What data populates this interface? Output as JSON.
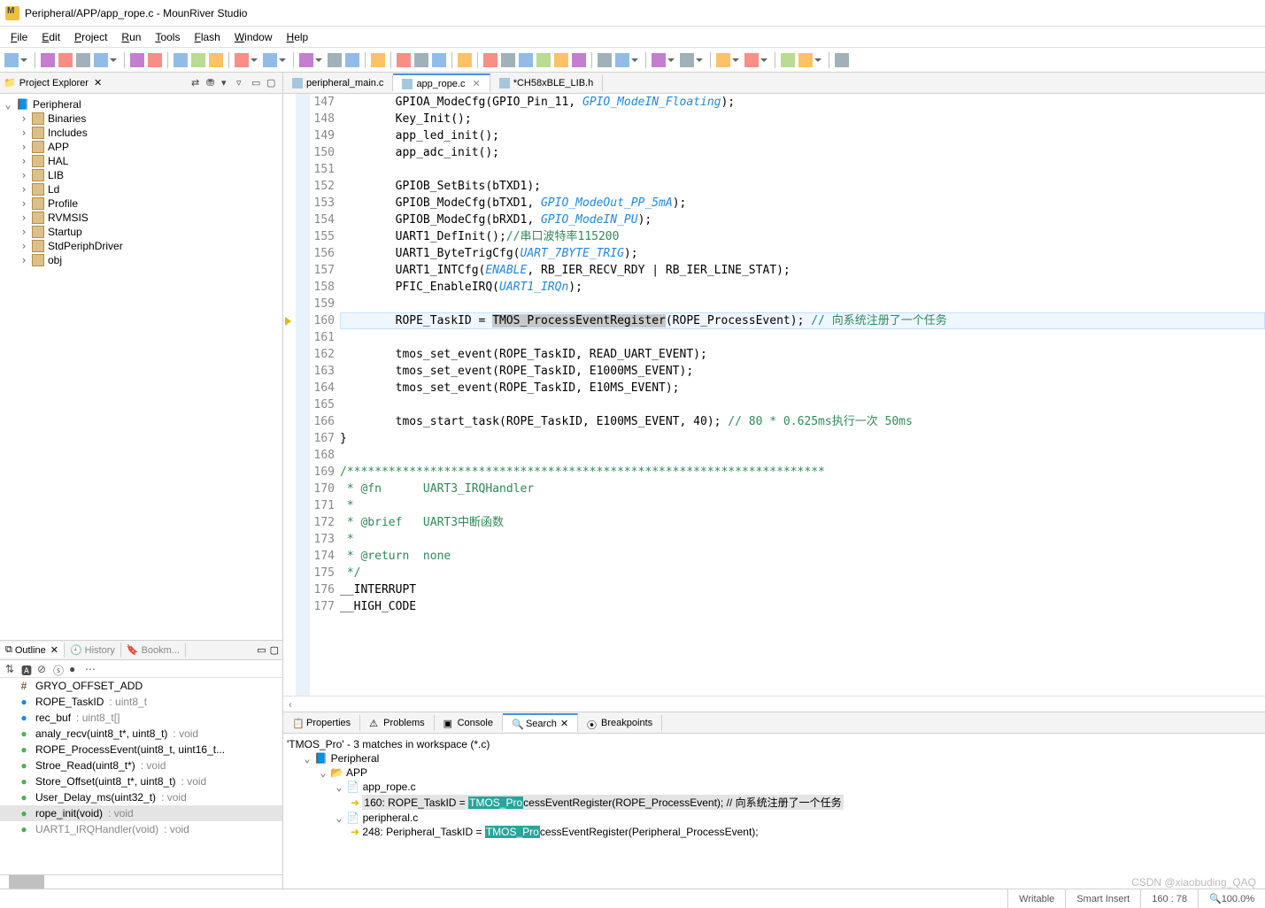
{
  "title": "Peripheral/APP/app_rope.c - MounRiver Studio",
  "menu": [
    "File",
    "Edit",
    "Project",
    "Run",
    "Tools",
    "Flash",
    "Window",
    "Help"
  ],
  "projectExplorer": {
    "title": "Project Explorer",
    "root": "Peripheral",
    "items": [
      "Binaries",
      "Includes",
      "APP",
      "HAL",
      "LIB",
      "Ld",
      "Profile",
      "RVMSIS",
      "Startup",
      "StdPeriphDriver",
      "obj"
    ]
  },
  "outline": {
    "tabs": [
      "Outline",
      "History",
      "Bookm..."
    ],
    "items": [
      {
        "k": "def",
        "t": "GRYO_OFFSET_ADD"
      },
      {
        "k": "var",
        "t": "ROPE_TaskID",
        "tp": "uint8_t"
      },
      {
        "k": "var",
        "t": "rec_buf",
        "tp": "uint8_t[]"
      },
      {
        "k": "func",
        "t": "analy_recv(uint8_t*, uint8_t)",
        "tp": "void"
      },
      {
        "k": "func",
        "t": "ROPE_ProcessEvent(uint8_t, uint16_t...",
        "tp": ""
      },
      {
        "k": "func",
        "t": "Stroe_Read(uint8_t*)",
        "tp": "void"
      },
      {
        "k": "func",
        "t": "Store_Offset(uint8_t*, uint8_t)",
        "tp": "void"
      },
      {
        "k": "func",
        "t": "User_Delay_ms(uint32_t)",
        "tp": "void"
      },
      {
        "k": "func",
        "t": "rope_init(void)",
        "tp": "void",
        "sel": true
      },
      {
        "k": "func",
        "t": "UART1_IRQHandler(void)",
        "tp": "void",
        "dim": true
      }
    ]
  },
  "editor": {
    "tabs": [
      {
        "name": "peripheral_main.c",
        "active": false
      },
      {
        "name": "app_rope.c",
        "active": true
      },
      {
        "name": "*CH58xBLE_LIB.h",
        "active": false
      }
    ],
    "firstLine": 147,
    "lines": [
      {
        "n": 147,
        "seg": [
          [
            "p",
            "        GPIOA_ModeCfg(GPIO_Pin_11, "
          ],
          [
            "kw",
            "GPIO_ModeIN_Floating"
          ],
          [
            "p",
            ");"
          ]
        ]
      },
      {
        "n": 148,
        "seg": [
          [
            "p",
            "        Key_Init();"
          ]
        ]
      },
      {
        "n": 149,
        "seg": [
          [
            "p",
            "        app_led_init();"
          ]
        ]
      },
      {
        "n": 150,
        "seg": [
          [
            "p",
            "        app_adc_init();"
          ]
        ]
      },
      {
        "n": 151,
        "seg": [
          [
            "p",
            ""
          ]
        ]
      },
      {
        "n": 152,
        "seg": [
          [
            "p",
            "        GPIOB_SetBits(bTXD1);"
          ]
        ]
      },
      {
        "n": 153,
        "seg": [
          [
            "p",
            "        GPIOB_ModeCfg(bTXD1, "
          ],
          [
            "kw",
            "GPIO_ModeOut_PP_5mA"
          ],
          [
            "p",
            ");"
          ]
        ]
      },
      {
        "n": 154,
        "seg": [
          [
            "p",
            "        GPIOB_ModeCfg(bRXD1, "
          ],
          [
            "kw",
            "GPIO_ModeIN_PU"
          ],
          [
            "p",
            ");"
          ]
        ]
      },
      {
        "n": 155,
        "seg": [
          [
            "p",
            "        UART1_DefInit();"
          ],
          [
            "cmt",
            "//串口波特率115200"
          ]
        ]
      },
      {
        "n": 156,
        "seg": [
          [
            "p",
            "        UART1_ByteTrigCfg("
          ],
          [
            "kw",
            "UART_7BYTE_TRIG"
          ],
          [
            "p",
            ");"
          ]
        ]
      },
      {
        "n": 157,
        "seg": [
          [
            "p",
            "        UART1_INTCfg("
          ],
          [
            "kw",
            "ENABLE"
          ],
          [
            "p",
            ", RB_IER_RECV_RDY | RB_IER_LINE_STAT);"
          ]
        ]
      },
      {
        "n": 158,
        "seg": [
          [
            "p",
            "        PFIC_EnableIRQ("
          ],
          [
            "kw",
            "UART1_IRQn"
          ],
          [
            "p",
            ");"
          ]
        ]
      },
      {
        "n": 159,
        "seg": [
          [
            "p",
            ""
          ]
        ]
      },
      {
        "n": 160,
        "seg": [
          [
            "p",
            "        ROPE_TaskID = "
          ],
          [
            "hl",
            "TMOS_ProcessEventRegister"
          ],
          [
            "p",
            "(ROPE_ProcessEvent); "
          ],
          [
            "cmt",
            "// 向系统注册了一个任务"
          ]
        ],
        "cur": true,
        "mark": true
      },
      {
        "n": 161,
        "seg": [
          [
            "p",
            ""
          ]
        ]
      },
      {
        "n": 162,
        "seg": [
          [
            "p",
            "        tmos_set_event(ROPE_TaskID, READ_UART_EVENT);"
          ]
        ]
      },
      {
        "n": 163,
        "seg": [
          [
            "p",
            "        tmos_set_event(ROPE_TaskID, E1000MS_EVENT);"
          ]
        ]
      },
      {
        "n": 164,
        "seg": [
          [
            "p",
            "        tmos_set_event(ROPE_TaskID, E10MS_EVENT);"
          ]
        ]
      },
      {
        "n": 165,
        "seg": [
          [
            "p",
            ""
          ]
        ]
      },
      {
        "n": 166,
        "seg": [
          [
            "p",
            "        tmos_start_task(ROPE_TaskID, E100MS_EVENT, 40); "
          ],
          [
            "cmt",
            "// 80 * 0.625ms执行一次 50ms"
          ]
        ]
      },
      {
        "n": 167,
        "seg": [
          [
            "p",
            "}"
          ]
        ]
      },
      {
        "n": 168,
        "seg": [
          [
            "p",
            ""
          ]
        ]
      },
      {
        "n": 169,
        "seg": [
          [
            "cmt",
            "/*********************************************************************"
          ]
        ]
      },
      {
        "n": 170,
        "seg": [
          [
            "cmt",
            " * @fn      UART3_IRQHandler"
          ]
        ]
      },
      {
        "n": 171,
        "seg": [
          [
            "cmt",
            " *"
          ]
        ]
      },
      {
        "n": 172,
        "seg": [
          [
            "cmt",
            " * @brief   UART3中断函数"
          ]
        ]
      },
      {
        "n": 173,
        "seg": [
          [
            "cmt",
            " *"
          ]
        ]
      },
      {
        "n": 174,
        "seg": [
          [
            "cmt",
            " * @return  none"
          ]
        ]
      },
      {
        "n": 175,
        "seg": [
          [
            "cmt",
            " */"
          ]
        ]
      },
      {
        "n": 176,
        "seg": [
          [
            "p",
            "__INTERRUPT"
          ]
        ]
      },
      {
        "n": 177,
        "seg": [
          [
            "p",
            "__HIGH_CODE"
          ]
        ]
      }
    ]
  },
  "bottom": {
    "tabs": [
      "Properties",
      "Problems",
      "Console",
      "Search",
      "Breakpoints"
    ],
    "active": "Search",
    "summary": "'TMOS_Pro' - 3 matches in workspace (*.c)",
    "root": "Peripheral",
    "folder": "APP",
    "file1": "app_rope.c",
    "match1_pre": "160: ROPE_TaskID = ",
    "match1_hl": "TMOS_Pro",
    "match1_post": "cessEventRegister(ROPE_ProcessEvent); // 向系统注册了一个任务",
    "file2": "peripheral.c",
    "match2_pre": "248: Peripheral_TaskID = ",
    "match2_hl": "TMOS_Pro",
    "match2_post": "cessEventRegister(Peripheral_ProcessEvent);"
  },
  "status": {
    "mode": "Writable",
    "insert": "Smart Insert",
    "pos": "160 : 78",
    "zoom": "100.0%"
  },
  "watermark": "CSDN @xiaobuding_QAQ"
}
